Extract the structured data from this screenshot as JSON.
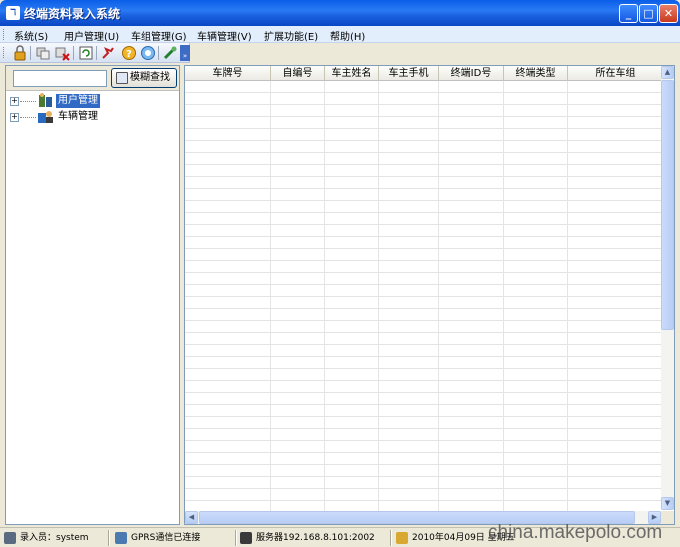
{
  "window": {
    "title": "终端资料录入系统",
    "app_icon_text": "ℸ",
    "controls": {
      "minimize": "_",
      "maximize": "□",
      "close": "✕"
    }
  },
  "menu": {
    "items": [
      {
        "label": "系统(S)"
      },
      {
        "label": "用户管理(U)"
      },
      {
        "label": "车组管理(G)"
      },
      {
        "label": "车辆管理(V)"
      },
      {
        "label": "扩展功能(E)"
      },
      {
        "label": "帮助(H)"
      }
    ]
  },
  "toolbar": {
    "icons": [
      "lock-icon",
      "user-group-icon",
      "user-delete-icon",
      "refresh-icon",
      "run-icon",
      "help-icon",
      "about-icon",
      "settings-icon"
    ],
    "overflow": "»"
  },
  "search": {
    "value": "",
    "button_label": "模糊查找"
  },
  "tree": {
    "nodes": [
      {
        "label": "用户管理",
        "expander": "+",
        "selected": true
      },
      {
        "label": "车辆管理",
        "expander": "+",
        "selected": false
      }
    ]
  },
  "grid": {
    "columns": [
      "车牌号",
      "自编号",
      "车主姓名",
      "车主手机",
      "终端ID号",
      "终端类型",
      "所在车组"
    ],
    "rows": []
  },
  "scroll": {
    "up": "▲",
    "down": "▼",
    "left": "◀",
    "right": "▶"
  },
  "status": {
    "operator": "录入员：system",
    "connection": "GPRS通信已连接",
    "server": "服务器192.168.8.101:2002",
    "datetime": "2010年04月09日 星期五"
  },
  "watermark": "china.makepolo.com",
  "colors": {
    "titlebar": "#0a5ee8",
    "menubar": "#e3eefc",
    "selection": "#316ac5",
    "window_bg": "#ece9d8"
  }
}
